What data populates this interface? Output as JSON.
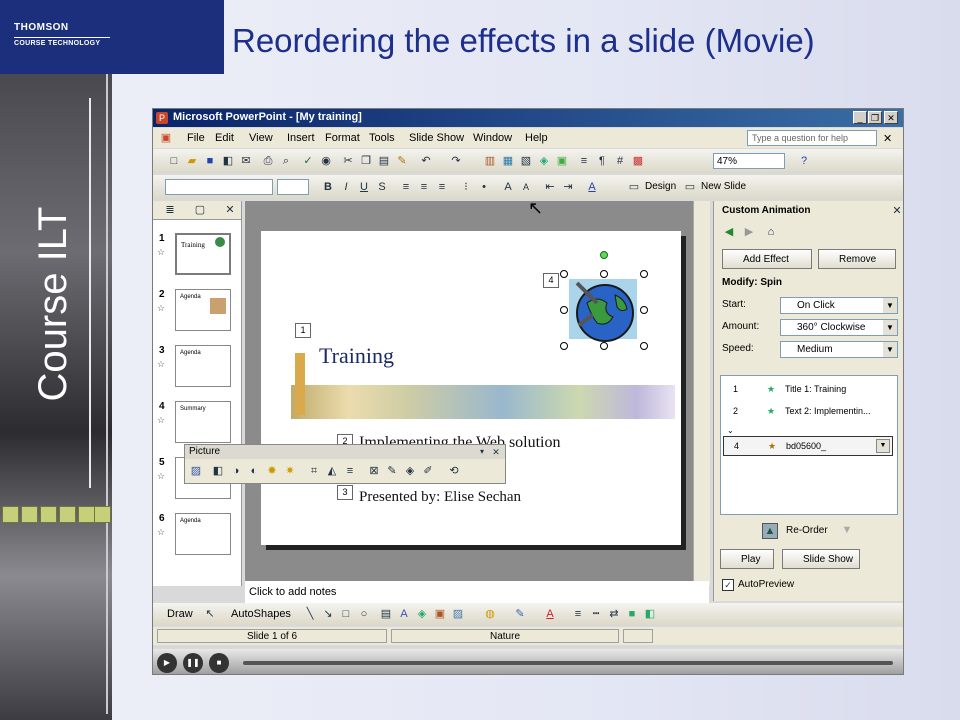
{
  "page": {
    "title": "Reordering the effects in a slide (Movie)",
    "side_text": "Course ILT",
    "logo_line1": "THOMSON",
    "logo_line2": "COURSE TECHNOLOGY"
  },
  "window": {
    "title": "Microsoft PowerPoint - [My training]",
    "controls": [
      "_",
      "❐",
      "✕"
    ]
  },
  "menu": {
    "items": [
      "File",
      "Edit",
      "View",
      "Insert",
      "Format",
      "Tools",
      "Slide Show",
      "Window",
      "Help"
    ],
    "help_placeholder": "Type a question for help"
  },
  "toolbar": {
    "zoom": "47%",
    "design_label": "Design",
    "new_slide_label": "New Slide"
  },
  "slides": {
    "numbers": [
      "1",
      "2",
      "3",
      "4",
      "5",
      "6"
    ],
    "thumb_texts": [
      "Training",
      "Agenda",
      "Agenda",
      "Summary",
      "",
      "Agenda"
    ]
  },
  "slide": {
    "heading": "Training",
    "subtitle": "Implementing the Web solution",
    "presenter": "Presented by: Elise Sechan",
    "tags": [
      "1",
      "2",
      "3",
      "4"
    ]
  },
  "picture_toolbar": {
    "title": "Picture"
  },
  "task_pane": {
    "title": "Custom Animation",
    "add_effect": "Add Effect",
    "remove": "Remove",
    "modify": "Modify: Spin",
    "start_label": "Start:",
    "start_value": "On Click",
    "amount_label": "Amount:",
    "amount_value": "360° Clockwise",
    "speed_label": "Speed:",
    "speed_value": "Medium",
    "animations": [
      {
        "num": "1",
        "text": "Title 1: Training"
      },
      {
        "num": "2",
        "text": "Text 2: Implementin..."
      },
      {
        "num": "4",
        "text": "bd05600_"
      }
    ],
    "reorder": "Re-Order",
    "play": "Play",
    "slide_show": "Slide Show",
    "autopreview": "AutoPreview"
  },
  "notes": {
    "placeholder": "Click to add notes"
  },
  "drawbar": {
    "draw": "Draw",
    "autoshapes": "AutoShapes"
  },
  "status": {
    "slide": "Slide 1 of 6",
    "design": "Nature"
  }
}
